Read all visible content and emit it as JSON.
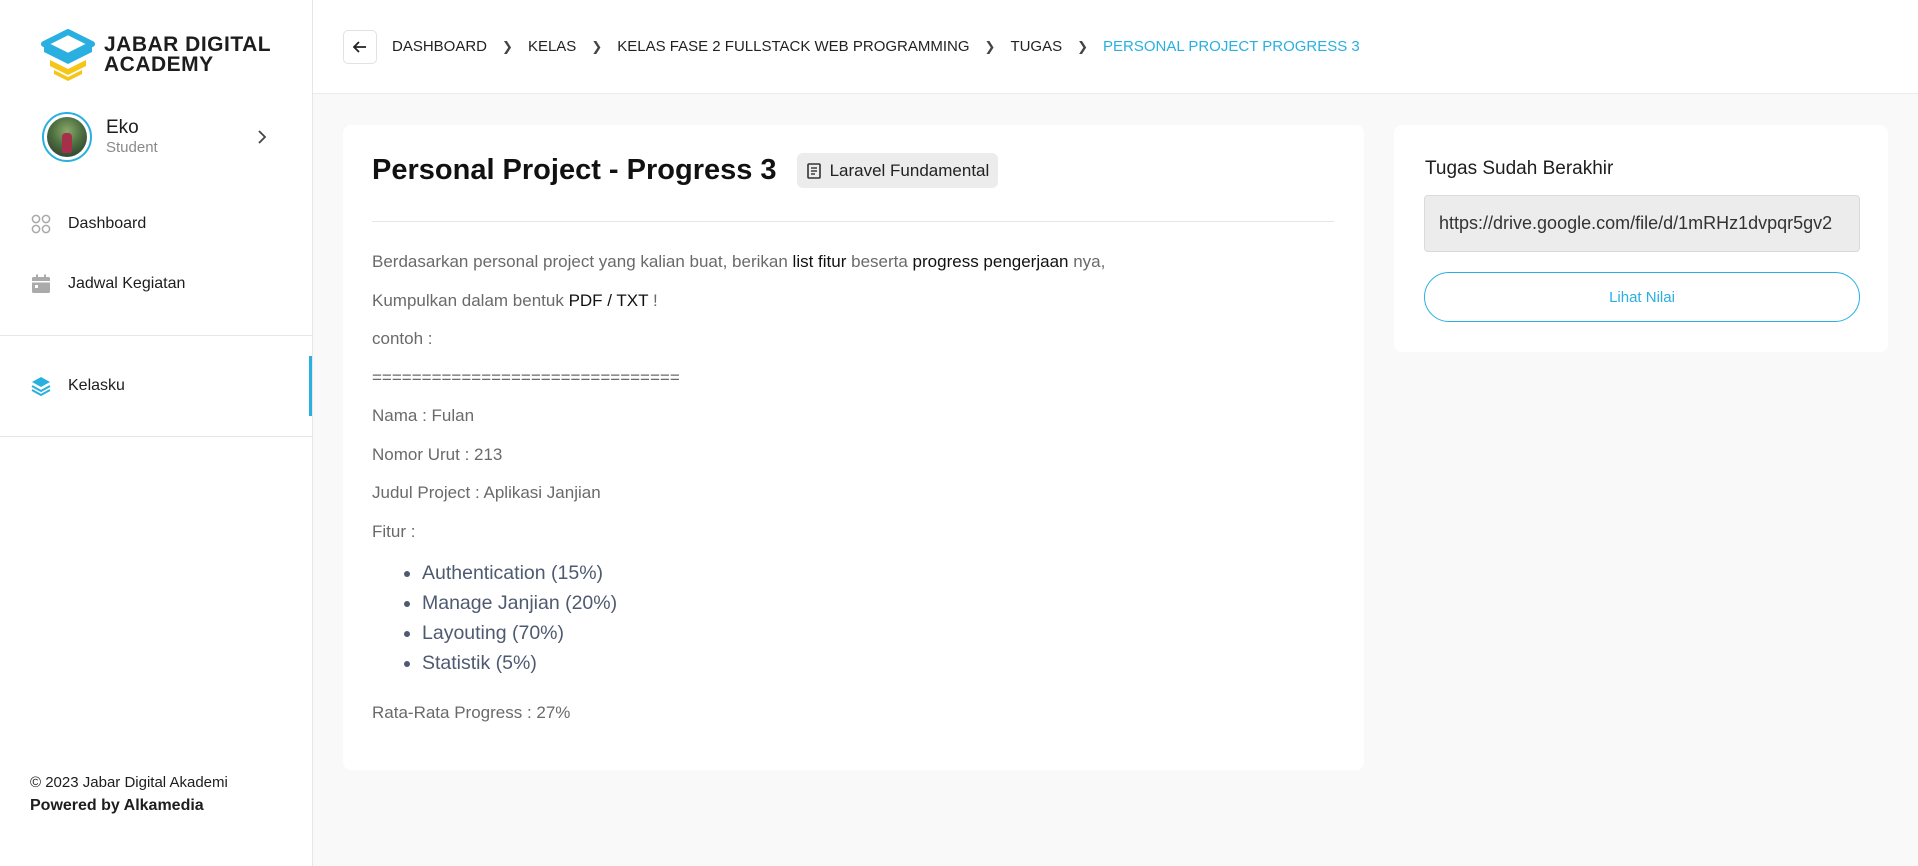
{
  "brand": {
    "line1": "JABAR DIGITAL",
    "line2": "ACADEMY",
    "colors": {
      "blue": "#2ab0e0",
      "yellow": "#f5c518"
    }
  },
  "user": {
    "name": "Eko",
    "role": "Student"
  },
  "nav": [
    {
      "label": "Dashboard",
      "icon": "grid-icon"
    },
    {
      "label": "Jadwal Kegiatan",
      "icon": "calendar-icon"
    },
    {
      "label": "Kelasku",
      "icon": "layers-icon",
      "active": true
    }
  ],
  "footer": {
    "copyright": "© 2023 Jabar Digital Akademi",
    "powered": "Powered by Alkamedia"
  },
  "breadcrumb": [
    "DASHBOARD",
    "KELAS",
    "KELAS FASE 2 FULLSTACK WEB PROGRAMMING",
    "TUGAS",
    "PERSONAL PROJECT PROGRESS 3"
  ],
  "task": {
    "title": "Personal Project - Progress 3",
    "tag": "Laravel Fundamental",
    "line1": {
      "a": "Berdasarkan personal project yang kalian buat, berikan ",
      "b": "list fitur",
      "c": " beserta ",
      "d": "progress pengerjaan",
      "e": " nya,"
    },
    "line2": {
      "a": "Kumpulkan dalam bentuk ",
      "b": "PDF / TXT",
      "c": " !"
    },
    "example_label": "contoh :",
    "separator": "===============================",
    "nama": "Nama : Fulan",
    "nomor": "Nomor Urut : 213",
    "judul": "Judul Project : Aplikasi Janjian",
    "fitur_label": "Fitur :",
    "fitur": [
      "Authentication (15%)",
      "Manage Janjian (20%)",
      "Layouting (70%)",
      "Statistik (5%)"
    ],
    "average": "Rata-Rata Progress : 27%"
  },
  "submission": {
    "status": "Tugas Sudah Berakhir",
    "link": "https://drive.google.com/file/d/1mRHz1dvpqr5gv2",
    "button": "Lihat Nilai"
  }
}
